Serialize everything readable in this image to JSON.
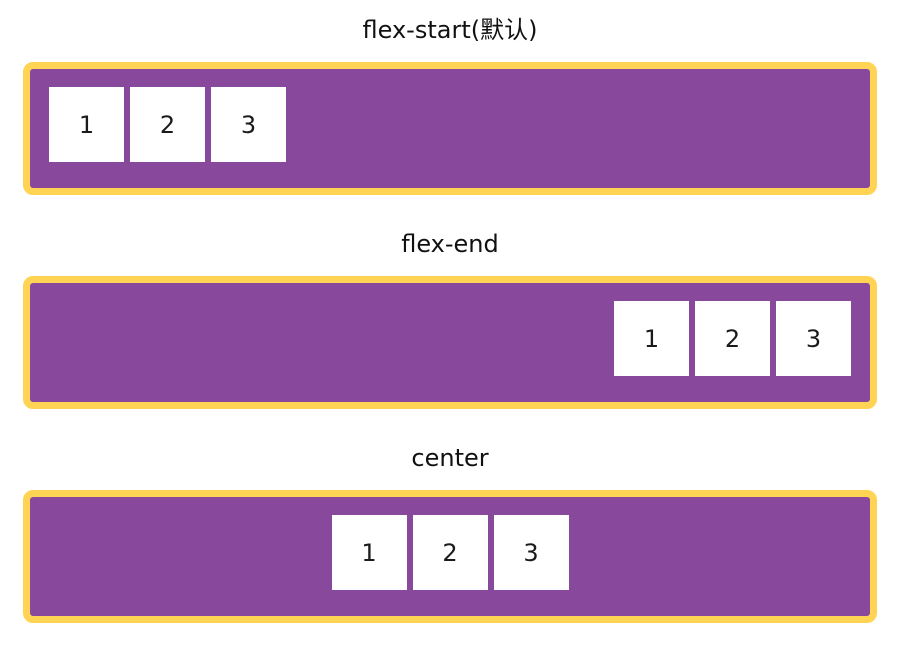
{
  "colors": {
    "container_background": "#88499c",
    "container_border": "#ffd454",
    "item_background": "#ffffff",
    "text": "#111111"
  },
  "sections": [
    {
      "title": "flex-start(默认)",
      "justify": "flex-start",
      "items": [
        "1",
        "2",
        "3"
      ]
    },
    {
      "title": "flex-end",
      "justify": "flex-end",
      "items": [
        "1",
        "2",
        "3"
      ]
    },
    {
      "title": "center",
      "justify": "center",
      "items": [
        "1",
        "2",
        "3"
      ]
    }
  ]
}
